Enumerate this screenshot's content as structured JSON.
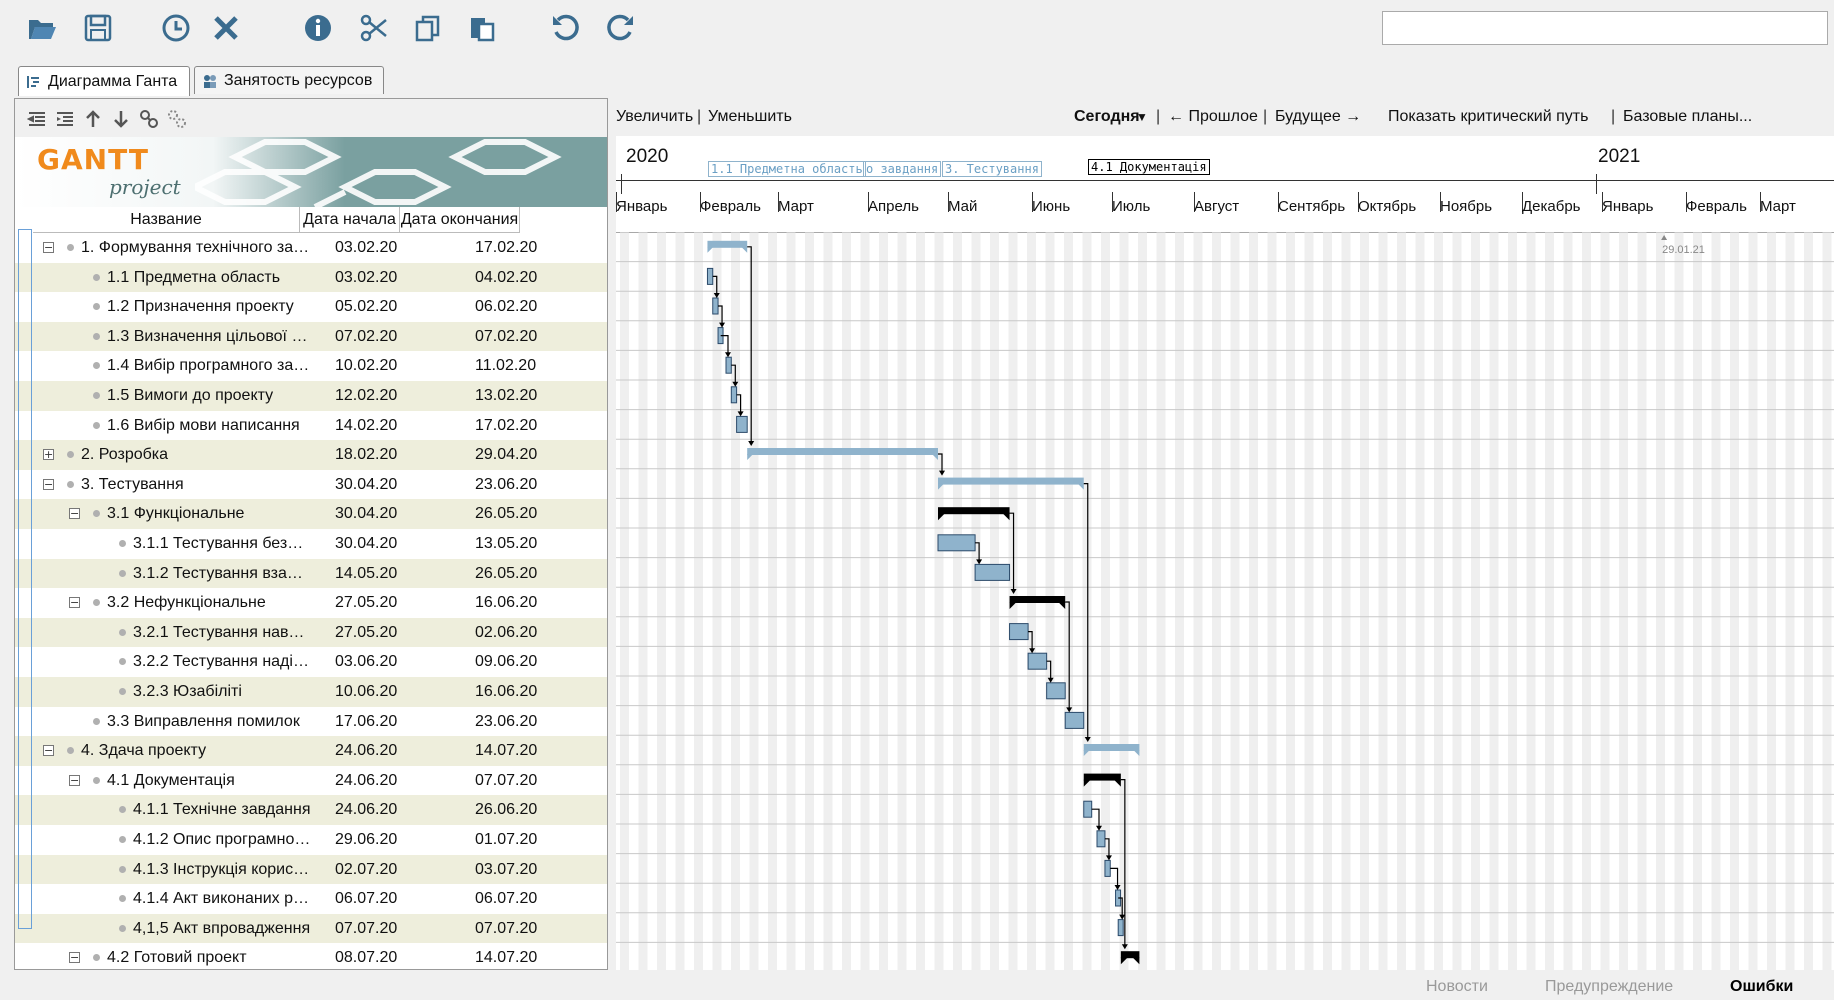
{
  "toolbar": {
    "buttons": [
      "open-icon",
      "save-icon",
      "clock-icon",
      "close-icon",
      "info-icon",
      "scissors-icon",
      "copy-icon",
      "paste-icon",
      "undo-icon",
      "redo-icon"
    ],
    "search_value": ""
  },
  "tabs": [
    {
      "label": "Диаграмма Ганта",
      "active": true
    },
    {
      "label": "Занятость ресурсов",
      "active": false
    }
  ],
  "left": {
    "logo_main": "GANTT",
    "logo_sub": "project",
    "columns": {
      "name": "Название",
      "start": "Дата начала",
      "end": "Дата окончания"
    }
  },
  "tasks": [
    {
      "name": "1. Формування технічного зав...",
      "start": "03.02.20",
      "end": "17.02.20",
      "level": 0,
      "expander": "minus"
    },
    {
      "name": "1.1 Предметна область",
      "start": "03.02.20",
      "end": "04.02.20",
      "level": 1,
      "expander": ""
    },
    {
      "name": "1.2 Призначення проекту",
      "start": "05.02.20",
      "end": "06.02.20",
      "level": 1,
      "expander": ""
    },
    {
      "name": "1.3 Визначення цільової ау...",
      "start": "07.02.20",
      "end": "07.02.20",
      "level": 1,
      "expander": ""
    },
    {
      "name": "1.4 Вибір програмного заб...",
      "start": "10.02.20",
      "end": "11.02.20",
      "level": 1,
      "expander": ""
    },
    {
      "name": "1.5 Вимоги до проекту",
      "start": "12.02.20",
      "end": "13.02.20",
      "level": 1,
      "expander": ""
    },
    {
      "name": "1.6 Вибір мови написання",
      "start": "14.02.20",
      "end": "17.02.20",
      "level": 1,
      "expander": ""
    },
    {
      "name": "2. Розробка",
      "start": "18.02.20",
      "end": "29.04.20",
      "level": 0,
      "expander": "plus"
    },
    {
      "name": "3. Тестування",
      "start": "30.04.20",
      "end": "23.06.20",
      "level": 0,
      "expander": "minus"
    },
    {
      "name": "3.1 Функціональне",
      "start": "30.04.20",
      "end": "26.05.20",
      "level": 1,
      "expander": "minus"
    },
    {
      "name": "3.1.1 Тестування безпеки",
      "start": "30.04.20",
      "end": "13.05.20",
      "level": 2,
      "expander": ""
    },
    {
      "name": "3.1.2 Тестування взаєм...",
      "start": "14.05.20",
      "end": "26.05.20",
      "level": 2,
      "expander": ""
    },
    {
      "name": "3.2 Нефункціональне",
      "start": "27.05.20",
      "end": "16.06.20",
      "level": 1,
      "expander": "minus"
    },
    {
      "name": "3.2.1 Тестування навант...",
      "start": "27.05.20",
      "end": "02.06.20",
      "level": 2,
      "expander": ""
    },
    {
      "name": "3.2.2 Тестування надійн...",
      "start": "03.06.20",
      "end": "09.06.20",
      "level": 2,
      "expander": ""
    },
    {
      "name": "3.2.3 Юзабіліті",
      "start": "10.06.20",
      "end": "16.06.20",
      "level": 2,
      "expander": ""
    },
    {
      "name": "3.3 Виправлення помилок",
      "start": "17.06.20",
      "end": "23.06.20",
      "level": 1,
      "expander": ""
    },
    {
      "name": "4. Здача проекту",
      "start": "24.06.20",
      "end": "14.07.20",
      "level": 0,
      "expander": "minus"
    },
    {
      "name": "4.1 Документація",
      "start": "24.06.20",
      "end": "07.07.20",
      "level": 1,
      "expander": "minus"
    },
    {
      "name": "4.1.1 Технічне завдання",
      "start": "24.06.20",
      "end": "26.06.20",
      "level": 2,
      "expander": ""
    },
    {
      "name": "4.1.2 Опис програмног...",
      "start": "29.06.20",
      "end": "01.07.20",
      "level": 2,
      "expander": ""
    },
    {
      "name": "4.1.3 Інструкція корист...",
      "start": "02.07.20",
      "end": "03.07.20",
      "level": 2,
      "expander": ""
    },
    {
      "name": "4.1.4 Акт виконаних ро...",
      "start": "06.07.20",
      "end": "06.07.20",
      "level": 2,
      "expander": ""
    },
    {
      "name": "4,1,5 Акт впровадження",
      "start": "07.07.20",
      "end": "07.07.20",
      "level": 2,
      "expander": ""
    },
    {
      "name": "4.2 Готовий проект",
      "start": "08.07.20",
      "end": "14.07.20",
      "level": 1,
      "expander": "minus"
    }
  ],
  "chart_toolbar": {
    "zoom_in": "Увеличить",
    "zoom_out": "Уменьшить",
    "today": "Сегодня",
    "past": "← Прошлое",
    "future": "Будущее →",
    "critical": "Показать критический путь",
    "baselines": "Базовые планы..."
  },
  "timeline": {
    "years": [
      "2020",
      "2021"
    ],
    "months": [
      "Январь",
      "Февраль",
      "Март",
      "Апрель",
      "Май",
      "Июнь",
      "Июль",
      "Август",
      "Сентябрь",
      "Октябрь",
      "Ноябрь",
      "Декабрь",
      "Январь",
      "Февраль",
      "Март"
    ],
    "overlay_labels": [
      "1.1 Предметна область",
      "о завдання",
      "3. Тестування"
    ],
    "highlight_label": "4.1 Документація",
    "today_label": "29.01.21"
  },
  "colors": {
    "task_fill": "#8fb3cc",
    "task_border": "#2b4a6a",
    "summary_light": "#8fb3cc",
    "summary_dark": "#000000",
    "row_alt": "#eeeedc",
    "grid": "#e8e8e8"
  },
  "status": {
    "news": "Новости",
    "warning": "Предупреждение",
    "errors": "Ошибки"
  }
}
